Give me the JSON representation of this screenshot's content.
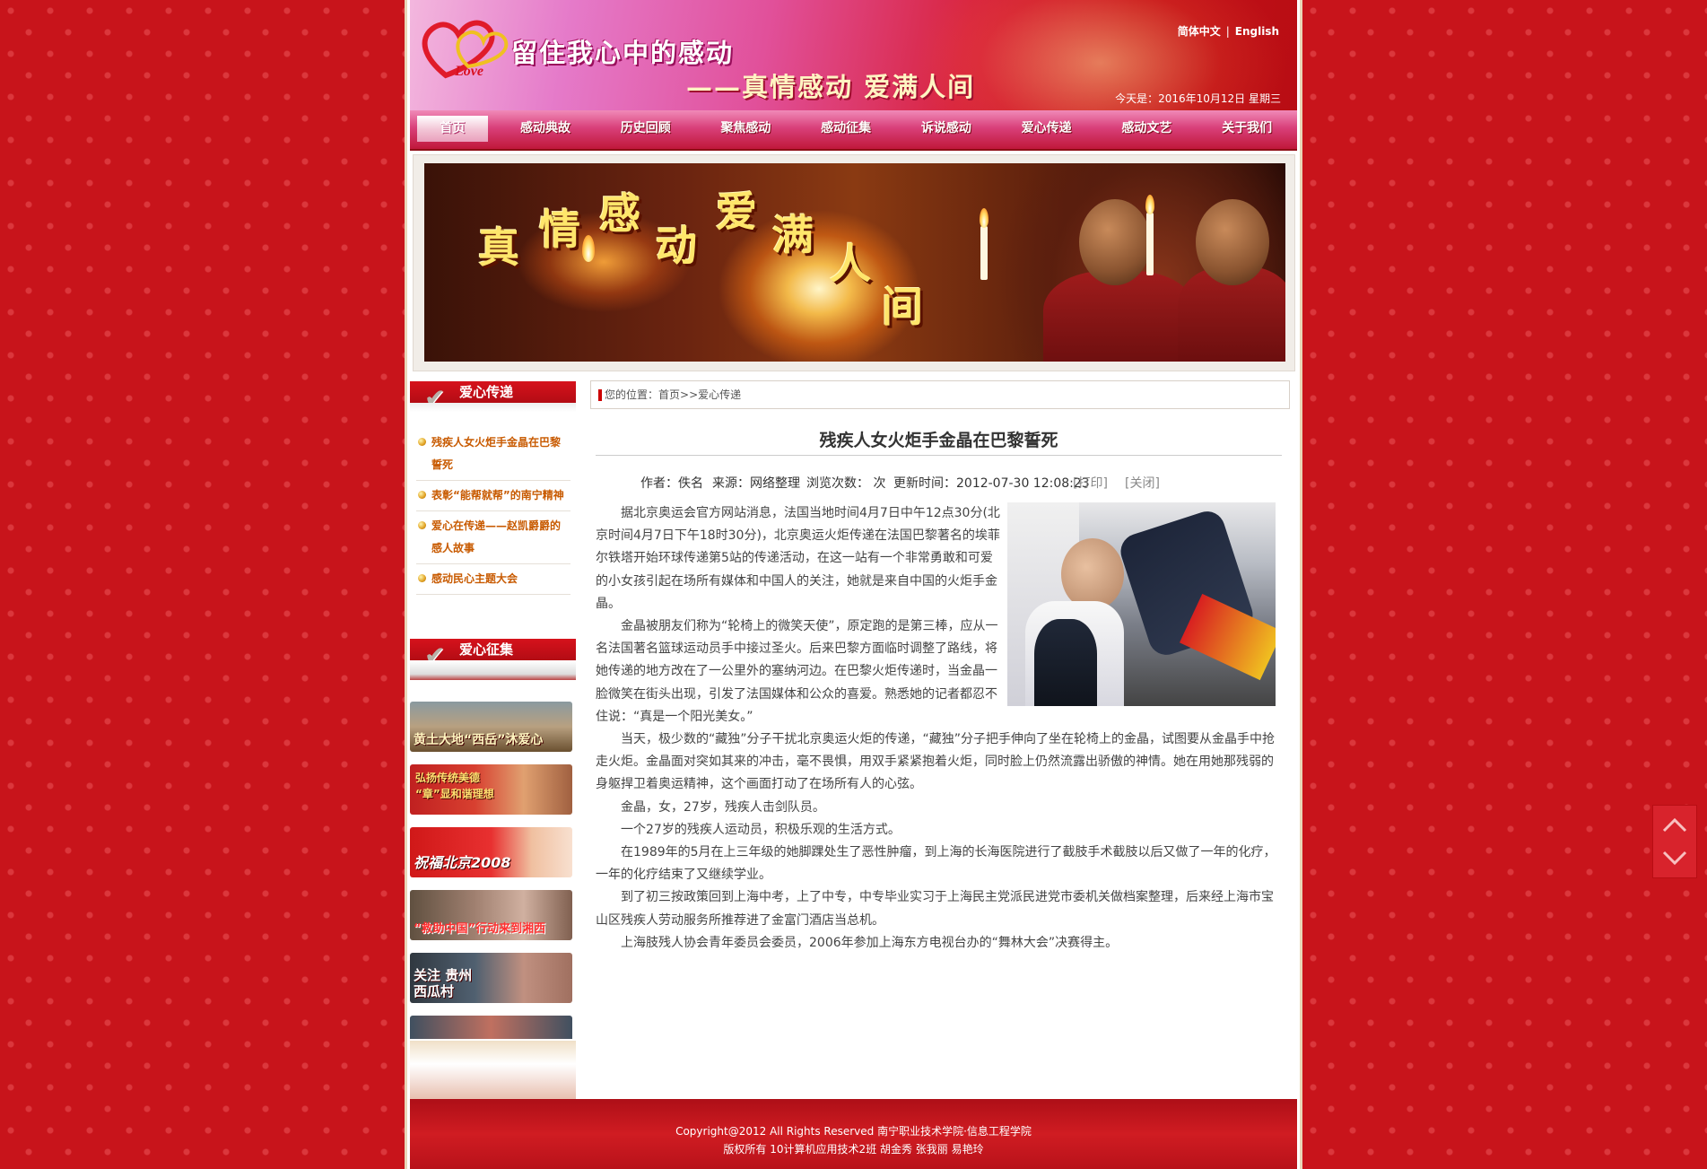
{
  "header": {
    "slogan1": "留住我心中的感动",
    "slogan2": "——真情感动  爱满人间",
    "logo_text": "Love",
    "lang_cn": "简体中文",
    "lang_sep": "|",
    "lang_en": "English",
    "date": "今天是：2016年10月12日 星期三"
  },
  "nav": [
    "首页",
    "感动典故",
    "历史回顾",
    "聚焦感动",
    "感动征集",
    "诉说感动",
    "爱心传递",
    "感动文艺",
    "关于我们"
  ],
  "banner": {
    "chars": [
      "真",
      "情",
      "感",
      "动",
      "爱",
      "满",
      "人",
      "间"
    ]
  },
  "sidebar": {
    "section1_title": "爱心传递",
    "news": [
      "残疾人女火炬手金晶在巴黎誓死",
      "表彰“能帮就帮”的南宁精神",
      "爱心在传递——赵凯爵爵的感人故事",
      "感动民心主题大会"
    ],
    "section2_title": "爱心征集",
    "thumbs": [
      {
        "caption": "黄土大地“西岳”沐爱心"
      },
      {
        "caption": "弘扬传统美德 “章”显和谐理想"
      },
      {
        "caption": "祝福北京2008"
      },
      {
        "caption": "“救助中国”行动来到湘西"
      },
      {
        "caption": "关注 贵州西瓜村"
      }
    ]
  },
  "breadcrumb": {
    "prefix": "您的位置：",
    "home": "首页",
    "sep": ">>",
    "current": "爱心传递"
  },
  "article": {
    "title": "残疾人女火炬手金晶在巴黎誓死",
    "author": "作者：佚名",
    "source": "来源：网络整理",
    "views": "浏览次数：  次",
    "time": "更新时间：2012-07-30 12:08:23",
    "print": "[打印]",
    "close": "[关闭]",
    "paragraphs": [
      "据北京奥运会官方网站消息，法国当地时间4月7日中午12点30分(北京时间4月7日下午18时30分)，北京奥运火炬传递在法国巴黎著名的埃菲尔铁塔开始环球传递第5站的传递活动，在这一站有一个非常勇敢和可爱的小女孩引起在场所有媒体和中国人的关注，她就是来自中国的火炬手金晶。",
      "金晶被朋友们称为“轮椅上的微笑天使”，原定跑的是第三棒，应从一名法国著名篮球运动员手中接过圣火。后来巴黎方面临时调整了路线，将她传递的地方改在了一公里外的塞纳河边。在巴黎火炬传递时，当金晶一脸微笑在街头出现，引发了法国媒体和公众的喜爱。熟悉她的记者都忍不住说：“真是一个阳光美女。”",
      "当天，极少数的“藏独”分子干扰北京奥运火炬的传递，“藏独”分子把手伸向了坐在轮椅上的金晶，试图要从金晶手中抢走火炬。金晶面对突如其来的冲击，毫不畏惧，用双手紧紧抱着火炬，同时脸上仍然流露出骄傲的神情。她在用她那残弱的身躯捍卫着奥运精神，这个画面打动了在场所有人的心弦。",
      "金晶，女，27岁，残疾人击剑队员。",
      "一个27岁的残疾人运动员，积极乐观的生活方式。",
      "在1989年的5月在上三年级的她脚踝处生了恶性肿瘤，到上海的长海医院进行了截肢手术截肢以后又做了一年的化疗，一年的化疗结束了又继续学业。",
      "到了初三按政策回到上海中考，上了中专，中专毕业实习于上海民主党派民进党市委机关做档案整理，后来经上海市宝山区残疾人劳动服务所推荐进了金富门酒店当总机。",
      "上海肢残人协会青年委员会委员，2006年参加上海东方电视台办的“舞林大会”决赛得主。"
    ]
  },
  "footer": {
    "line1": "Copyright@2012 All Rights Reserved 南宁职业技术学院·信息工程学院",
    "line2": "版权所有 10计算机应用技术2班 胡金秀 张我丽 易艳玲"
  },
  "colors": {
    "brand_red": "#c8141b",
    "link_orange": "#c85a00",
    "nav_pink": "#d9407a"
  }
}
